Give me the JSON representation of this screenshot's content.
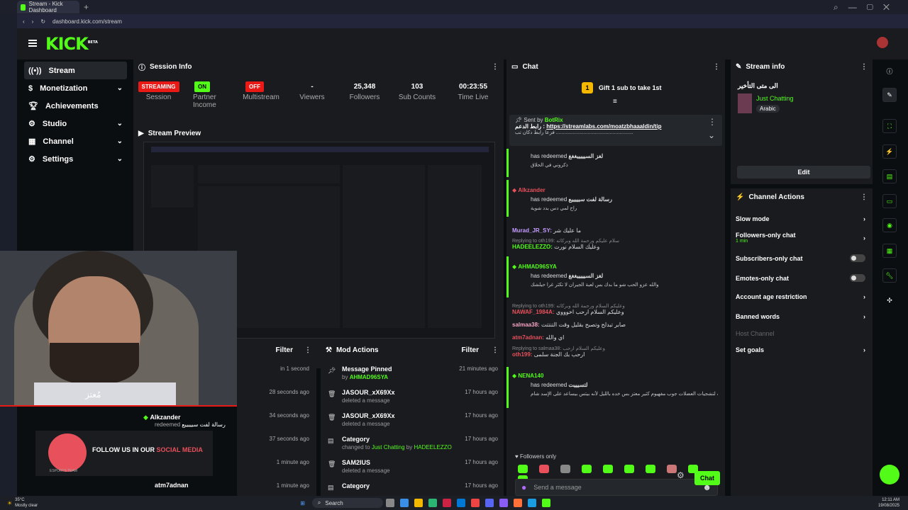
{
  "browser": {
    "tab_title": "Stream - Kick Dashboard",
    "url": "dashboard.kick.com/stream"
  },
  "app": {
    "logo": "KICK",
    "logo_suffix": "BETA",
    "accent": "#53fc18"
  },
  "nav": [
    {
      "label": "Stream",
      "icon": "broadcast-icon"
    },
    {
      "label": "Monetization",
      "icon": "dollar-icon"
    },
    {
      "label": "Achievements",
      "icon": "trophy-icon"
    },
    {
      "label": "Studio",
      "icon": "gear-icon"
    },
    {
      "label": "Channel",
      "icon": "channel-icon"
    },
    {
      "label": "Settings",
      "icon": "settings-icon"
    }
  ],
  "session": {
    "title": "Session Info",
    "stats": [
      {
        "value": "STREAMING",
        "label": "Session",
        "badge": "red"
      },
      {
        "value": "ON",
        "label": "Partner Income",
        "badge": "green"
      },
      {
        "value": "OFF",
        "label": "Multistream",
        "badge": "red"
      },
      {
        "value": "-",
        "label": "Viewers"
      },
      {
        "value": "25,348",
        "label": "Followers"
      },
      {
        "value": "103",
        "label": "Sub Counts"
      },
      {
        "value": "00:23:55",
        "label": "Time Live"
      }
    ]
  },
  "preview": {
    "title": "Stream Preview"
  },
  "overlay": {
    "arabic_name": "مُعتز",
    "follow_text": "FOLLOW US IN OUR ",
    "follow_highlight": "SOCIAL MEDIA",
    "team": "ESPORTS TEAM"
  },
  "activity": {
    "filter": "Filter",
    "items": [
      {
        "time": "in 1 second"
      },
      {
        "time": "28 seconds ago"
      },
      {
        "user": "Alkzander",
        "text": "redeemed",
        "reward": "رسالة لفت سيييييع",
        "time": "34 seconds ago"
      },
      {
        "time": "37 seconds ago"
      },
      {
        "time": "1 minute ago"
      },
      {
        "user": "atm7adnan",
        "time": "1 minute ago"
      }
    ]
  },
  "mod_actions": {
    "title": "Mod Actions",
    "filter": "Filter",
    "items": [
      {
        "action": "Message Pinned",
        "sub": "by",
        "who": "AHMAD96SYA",
        "time": "21 minutes ago",
        "icon": "pin-icon"
      },
      {
        "action": "JASOUR_xX69Xx",
        "sub": "deleted a message",
        "time": "17 hours ago",
        "icon": "trash-icon"
      },
      {
        "action": "JASOUR_xX69Xx",
        "sub": "deleted a message",
        "time": "17 hours ago",
        "icon": "trash-icon"
      },
      {
        "action": "Category",
        "sub": "changed to",
        "cat": "Just Chatting",
        "by": "by",
        "who": "HADEELEZZO",
        "time": "17 hours ago",
        "icon": "category-icon"
      },
      {
        "action": "SAM2IUS",
        "sub": "deleted a message",
        "time": "17 hours ago",
        "icon": "trash-icon"
      },
      {
        "action": "Category",
        "time": "17 hours ago",
        "icon": "category-icon"
      }
    ]
  },
  "chat": {
    "title": "Chat",
    "gift_count": "1",
    "gift_text": "Gift 1 sub to take 1st",
    "pinned": {
      "sent_by": "Sent by",
      "bot": "BotRix",
      "prefix": "رابط الدعم : ",
      "link": "https://streamlabs.com/moatzbhaaaldin/tip",
      "line2": "فزعا رابط دكان تب ........................................................"
    },
    "messages": [
      {
        "type": "redeem",
        "user": "",
        "text": "has redeemed",
        "reward": "لغز السيييييغغغ",
        "msg": "ذكروني في الحلاق"
      },
      {
        "type": "redeem",
        "user": "Alkzander",
        "text": "has redeemed",
        "reward": "رسالة لفت سيييييع",
        "msg": "راح لمي دس بدد شوية"
      },
      {
        "type": "msg",
        "user": "Murad_JR_SY:",
        "text": "ما عليك شر"
      },
      {
        "type": "reply",
        "reply": "Replying to oth199: سلام عليكم ورحمة الله وبركاته",
        "user": "HADEELEZZO:",
        "text": "وعليك السلام نورت"
      },
      {
        "type": "redeem",
        "user": "AHMAD96SYA",
        "text": "has redeemed",
        "reward": "لغز السيييييغغغ",
        "msg": "والله عزو الحب شو ما بدك بس لعبة الجيران لا تكثر غرا حيلشك"
      },
      {
        "type": "reply",
        "reply": "Replying to oth199: وعليكم السلام ورحمة الله وبركاته",
        "user": "NAWAF_1984A:",
        "text": "وعليكم السلام ارحب اخوووي"
      },
      {
        "type": "msg",
        "user": "salmaa38:",
        "text": "صابر تبدلح وتصبح بقليل وقت التنتتت"
      },
      {
        "type": "msg",
        "user": "atm7adnan:",
        "text": "اي والله"
      },
      {
        "type": "reply",
        "reply": "Replying to salmaa38: وعليكم السلام ارحب",
        "user": "oth199:",
        "text": "ارحب بك الجنة سلمى"
      },
      {
        "type": "redeem",
        "user": "NENA140",
        "text": "has redeemed",
        "reward": "لتسيييت",
        "msg": "معتز بالنسبه لتشجيات العضلات جوب مفهيوم كثير معتز بس خده بالليل لأنه بيتس بيساعد على الإسد شام"
      }
    ],
    "followers_only": "Followers only",
    "input_placeholder": "Send a message",
    "send": "Chat"
  },
  "stream_info": {
    "title": "Stream info",
    "stream_title": "الى متى التأخير",
    "category": "Just Chatting",
    "language": "Arabic",
    "edit": "Edit"
  },
  "channel_actions": {
    "title": "Channel Actions",
    "items": [
      {
        "label": "Slow mode",
        "kind": "chevron"
      },
      {
        "label": "Followers-only chat",
        "sub": "1 min",
        "kind": "chevron"
      },
      {
        "label": "Subscribers-only chat",
        "kind": "toggle"
      },
      {
        "label": "Emotes-only chat",
        "kind": "toggle"
      },
      {
        "label": "Account age restriction",
        "kind": "chevron"
      },
      {
        "label": "Banned words",
        "kind": "chevron"
      },
      {
        "label": "Host Channel",
        "kind": "disabled"
      },
      {
        "label": "Set goals",
        "kind": "chevron"
      }
    ]
  },
  "taskbar": {
    "weather_temp": "35°C",
    "weather_desc": "Mostly clear",
    "search": "Search",
    "time": "12:11 AM",
    "date": "19/08/2025"
  }
}
